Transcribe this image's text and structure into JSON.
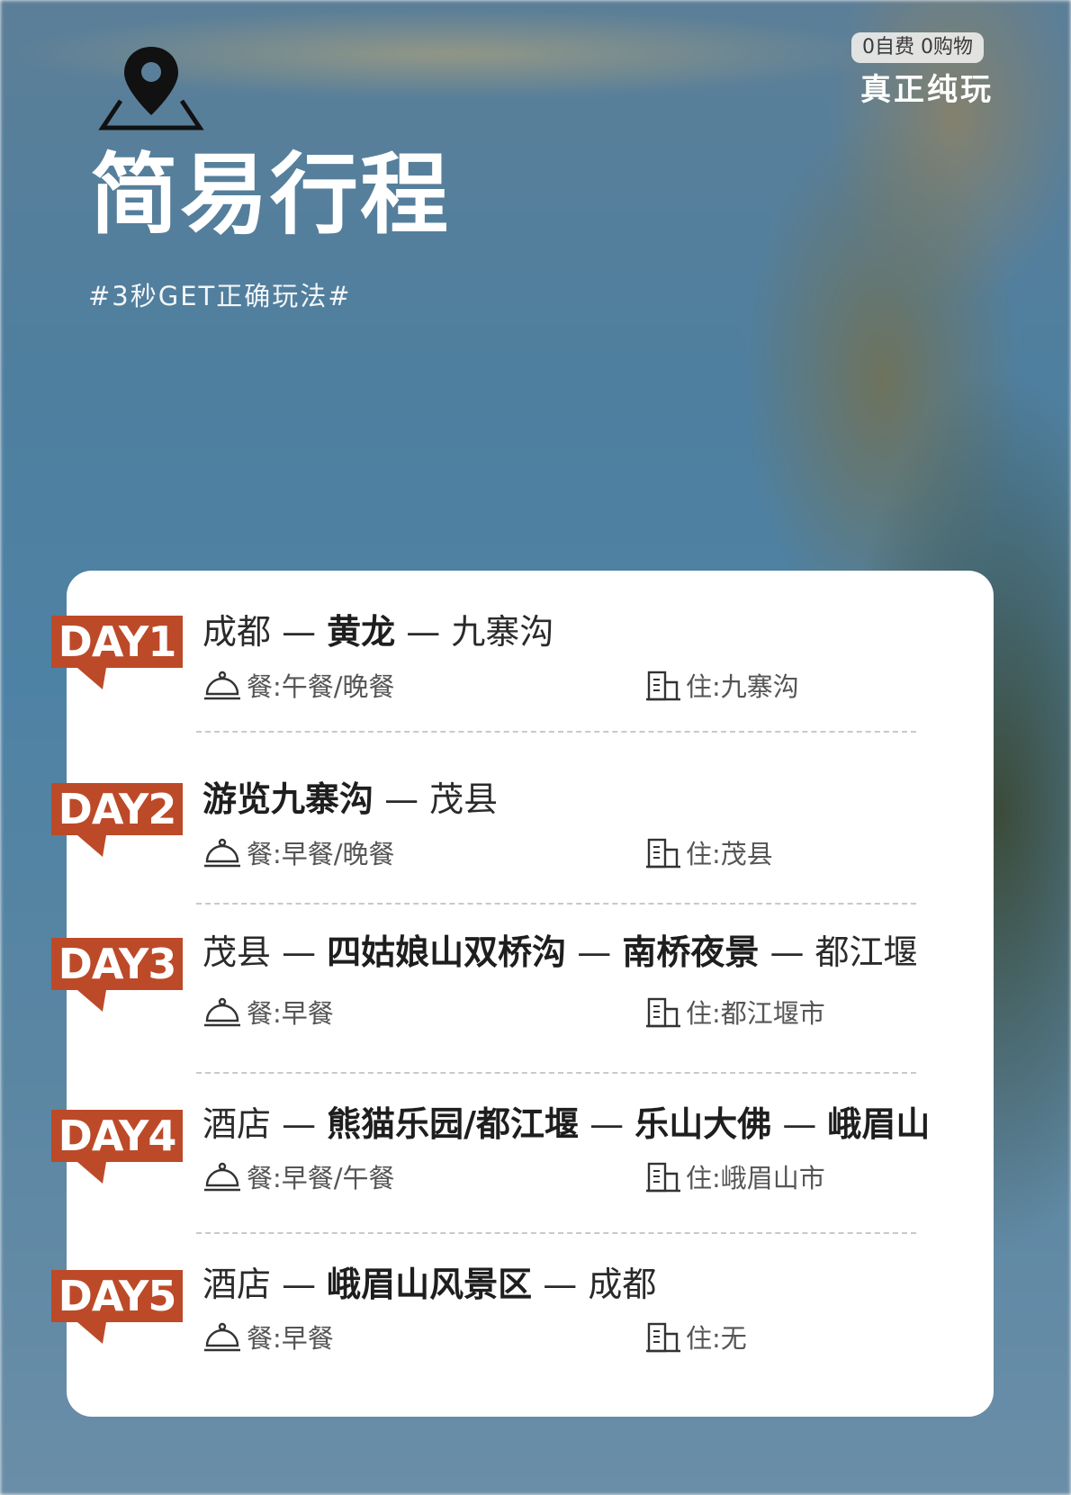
{
  "header": {
    "title": "简易行程",
    "subtitle": "#3秒GET正确玩法#",
    "tag_top": "0自费 0购物",
    "tag_main": "真正纯玩",
    "location_icon": "map-pin-icon"
  },
  "colors": {
    "badge": "#bc4a28",
    "card": "#ffffff",
    "text": "#2a2a2a"
  },
  "days": [
    {
      "badge": "DAY1",
      "route": [
        "成都 — ",
        "黄龙",
        " — 九寨沟"
      ],
      "meal": "餐:午餐/晚餐",
      "stay": "住:九寨沟"
    },
    {
      "badge": "DAY2",
      "route": [
        "",
        "游览九寨沟",
        " — 茂县"
      ],
      "meal": "餐:早餐/晚餐",
      "stay": "住:茂县"
    },
    {
      "badge": "DAY3",
      "route": [
        "茂县 — ",
        "四姑娘山双桥沟",
        " — ",
        "南桥夜景",
        " — 都江堰"
      ],
      "meal": "餐:早餐",
      "stay": "住:都江堰市"
    },
    {
      "badge": "DAY4",
      "route": [
        "酒店 — ",
        "熊猫乐园/都江堰",
        " — ",
        "乐山大佛",
        " — ",
        "峨眉山"
      ],
      "meal": "餐:早餐/午餐",
      "stay": "住:峨眉山市"
    },
    {
      "badge": "DAY5",
      "route": [
        "酒店 — ",
        "峨眉山风景区",
        " — 成都"
      ],
      "meal": "餐:早餐",
      "stay": "住:无"
    }
  ]
}
